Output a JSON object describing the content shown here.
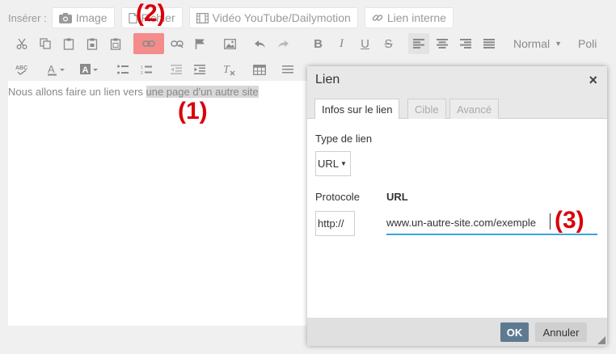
{
  "insert_bar": {
    "label": "Insérer :",
    "buttons": [
      {
        "label": "Image",
        "icon": "camera-icon"
      },
      {
        "label": "Fichier",
        "icon": "file-icon"
      },
      {
        "label": "Vidéo YouTube/Dailymotion",
        "icon": "film-icon"
      },
      {
        "label": "Lien interne",
        "icon": "link-icon"
      }
    ]
  },
  "toolbar": {
    "format_dropdown": "Normal",
    "font_dropdown": "Poli",
    "highlight_color": "#f48c8c"
  },
  "editor": {
    "text_before": "Nous allons faire un lien vers ",
    "selected_text": "une page d'un autre site"
  },
  "annotations": {
    "one": "(1)",
    "two": "(2)",
    "three": "(3)"
  },
  "dialog": {
    "title": "Lien",
    "close": "×",
    "tabs": [
      {
        "label": "Infos sur le lien",
        "active": true
      },
      {
        "label": "Cible",
        "active": false
      },
      {
        "label": "Avancé",
        "active": false
      }
    ],
    "link_type_label": "Type de lien",
    "link_type_value": "URL",
    "protocol_label": "Protocole",
    "protocol_value": "http://",
    "url_label": "URL",
    "url_value": "www.un-autre-site.com/exemple",
    "ok_label": "OK",
    "cancel_label": "Annuler",
    "accent_color": "#3aa6d8",
    "ok_color": "#5d7a91"
  }
}
